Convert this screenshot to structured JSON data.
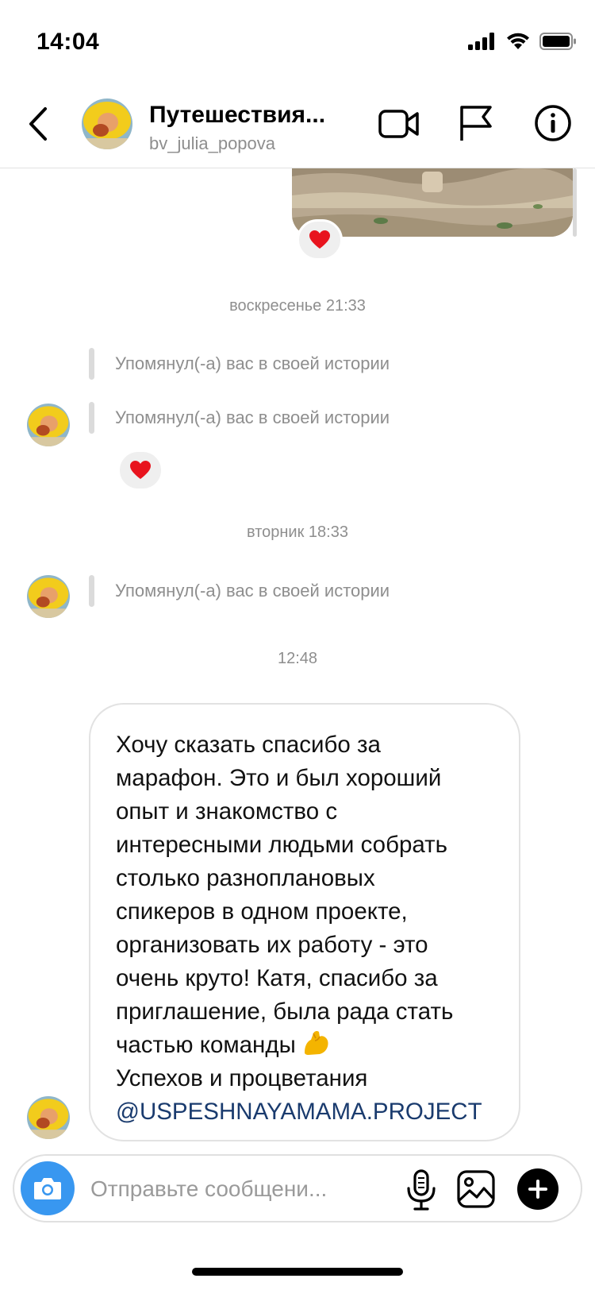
{
  "status_bar": {
    "time": "14:04",
    "icons": [
      "signal-icon",
      "wifi-icon",
      "battery-icon"
    ]
  },
  "header": {
    "title": "Путешествия...",
    "username": "bv_julia_popova",
    "icons": [
      "back-arrow-icon",
      "video-call-icon",
      "flag-icon",
      "info-icon"
    ]
  },
  "chat": {
    "timestamps": [
      "воскресенье 21:33",
      "вторник 18:33",
      "12:48"
    ],
    "story_mention_text": "Упомянул(-а) вас в своей истории",
    "reaction_emoji": "heart-icon",
    "message": {
      "text": "Хочу сказать спасибо за\nмарафон. Это и был  хороший\nопыт и знакомство с\nинтересными людьми собрать\nстолько разноплановых\nспикеров в одном проекте,\nорганизовать их работу - это\nочень круто! Катя, спасибо за\nприглашение, была рада стать\nчастью команды",
      "emoji": "flexed-biceps-icon",
      "closing": "Успехов и процветания",
      "mention": "@USPESHNAYAMAMA.PROJECT"
    }
  },
  "composer": {
    "placeholder": "Отправьте сообщени...",
    "icons": [
      "camera-icon",
      "microphone-icon",
      "gallery-icon",
      "plus-icon"
    ]
  },
  "colors": {
    "accent_blue": "#3897f0",
    "mention_link": "#1a3b6e",
    "secondary_text": "#8e8e8e",
    "reaction_heart": "#e8141e"
  }
}
